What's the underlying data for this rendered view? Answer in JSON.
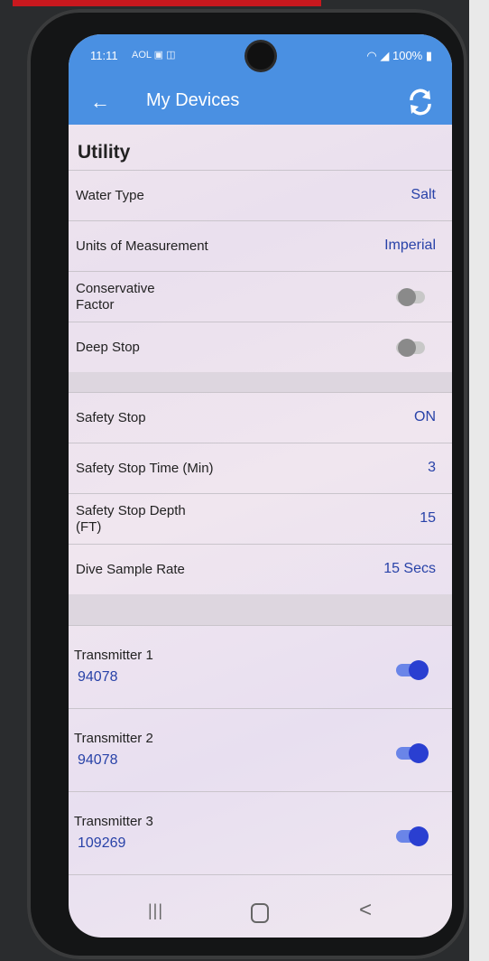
{
  "status": {
    "time": "11:11",
    "left_icons": "AOL ▣ ◫",
    "battery": "100%"
  },
  "header": {
    "title": "My Devices",
    "back_icon": "arrow-left-icon",
    "refresh_icon": "refresh-icon"
  },
  "utility": {
    "heading": "Utility",
    "rows": [
      {
        "label": "Water Type",
        "value": "Salt"
      },
      {
        "label": "Units of Measurement",
        "value": "Imperial"
      },
      {
        "label_line1": "Conservative",
        "label_line2": "Factor",
        "toggle": false
      },
      {
        "label": "Deep Stop",
        "toggle": false
      }
    ]
  },
  "safety": {
    "rows": [
      {
        "label": "Safety Stop",
        "value": "ON"
      },
      {
        "label": "Safety Stop Time (Min)",
        "value": "3"
      },
      {
        "label_line1": "Safety Stop Depth",
        "label_line2": "(FT)",
        "value": "15"
      },
      {
        "label": "Dive Sample Rate",
        "value": "15 Secs"
      }
    ]
  },
  "transmitters": [
    {
      "name": "Transmitter 1",
      "id": "94078",
      "enabled": true
    },
    {
      "name": "Transmitter 2",
      "id": "94078",
      "enabled": true
    },
    {
      "name": "Transmitter 3",
      "id": "109269",
      "enabled": true
    }
  ],
  "navbar": {
    "recent": "|||",
    "back": "<"
  },
  "colors": {
    "accent": "#4a90e2",
    "value_text": "#2842a8",
    "toggle_on": "#2a3fd1"
  }
}
